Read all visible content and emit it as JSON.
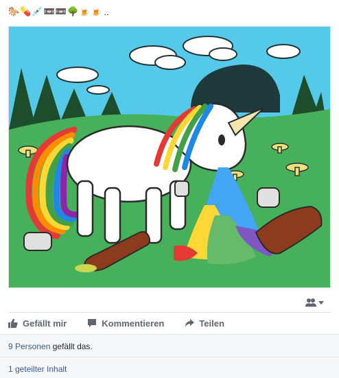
{
  "header": {
    "emoji_icons": [
      "horse-icon",
      "pill-icon",
      "syringe-icon",
      "cassette-icon",
      "cassette-icon",
      "tree-icon",
      "beer-icon",
      "beer-icon"
    ],
    "emoji_glyphs": [
      "🐎",
      "💊",
      "💉",
      "📼",
      "📼",
      "🌳",
      "🍺",
      "🍺"
    ],
    "trailing": ".."
  },
  "post_image": {
    "icon": "unicorn-drawing",
    "colors": {
      "sky": "#55c9ea",
      "grass": "#46b05a",
      "unicorn": "#ffffff",
      "bottle": "#8c3b1d"
    }
  },
  "audience": {
    "icon": "friends-icon"
  },
  "actions": {
    "like_label": "Gefällt mir",
    "comment_label": "Kommentieren",
    "share_label": "Teilen"
  },
  "likes": {
    "count_link": "9 Personen",
    "suffix": " gefällt das."
  },
  "shares": {
    "link": "1 geteilter Inhalt"
  },
  "colors": {
    "link": "#365899",
    "secondary_text": "#606770",
    "footer_bg": "#f6f7f9"
  }
}
